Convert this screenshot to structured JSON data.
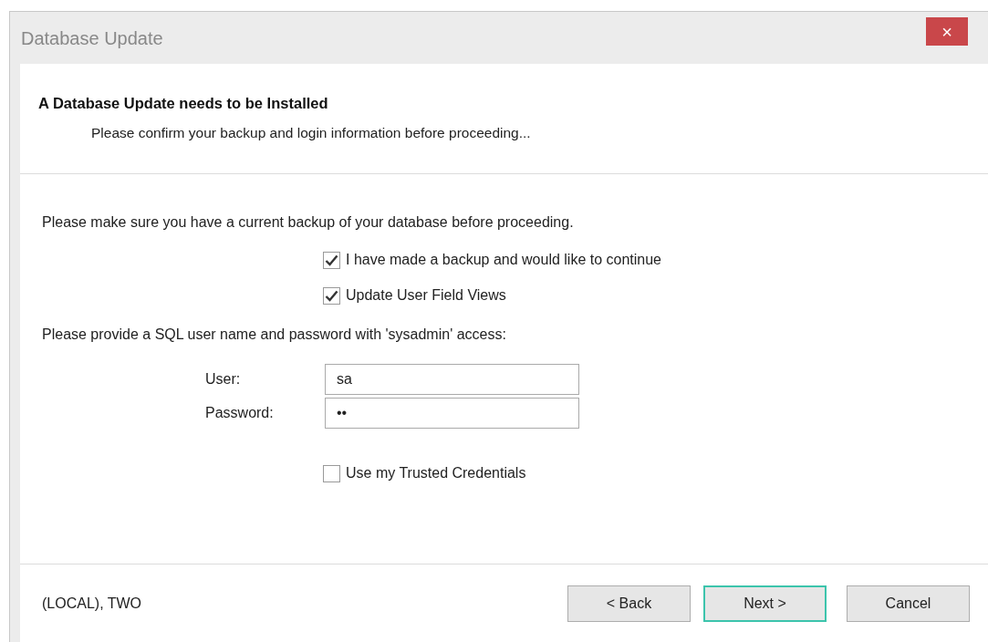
{
  "window": {
    "title": "Database Update",
    "close": "×"
  },
  "header": {
    "title": "A Database Update needs to be Installed",
    "subtitle": "Please confirm your backup and login information before proceeding..."
  },
  "backup_note": "Please make sure you have a current backup of your database before proceeding.",
  "options": [
    {
      "label": "I have made a backup and would like to continue",
      "checked": true
    },
    {
      "label": "Update User Field Views",
      "checked": true
    }
  ],
  "login_note": "Please provide a SQL user name and password with 'sysadmin' access:",
  "fields": [
    {
      "label": "User:",
      "value": "sa"
    },
    {
      "label": "Password:",
      "value": "••"
    }
  ],
  "trusted": {
    "label": "Use my Trusted Credentials",
    "checked": false
  },
  "status": "(LOCAL), TWO",
  "buttons": [
    {
      "label": "< Back",
      "focused": false
    },
    {
      "label": "Next >",
      "focused": true
    },
    {
      "label": "Cancel",
      "focused": false
    }
  ]
}
